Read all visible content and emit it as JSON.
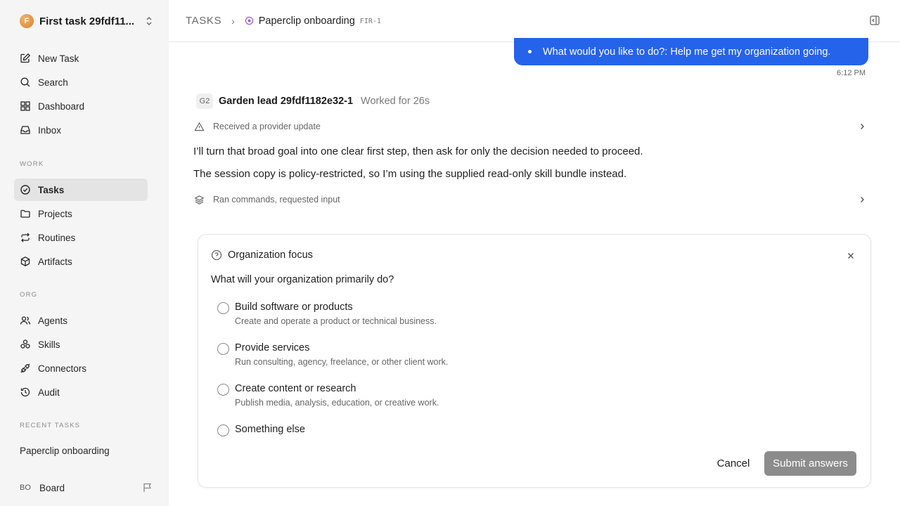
{
  "sidebar": {
    "org_name": "First task 29fdf11...",
    "org_initial": "F",
    "top_items": [
      {
        "label": "New Task",
        "icon": "edit-icon"
      },
      {
        "label": "Search",
        "icon": "search-icon"
      },
      {
        "label": "Dashboard",
        "icon": "dashboard-icon"
      },
      {
        "label": "Inbox",
        "icon": "inbox-icon"
      }
    ],
    "work_label": "WORK",
    "work_items": [
      {
        "label": "Tasks",
        "icon": "check-circle-icon"
      },
      {
        "label": "Projects",
        "icon": "folder-icon"
      },
      {
        "label": "Routines",
        "icon": "repeat-icon"
      },
      {
        "label": "Artifacts",
        "icon": "box-icon"
      }
    ],
    "org_label": "ORG",
    "org_items": [
      {
        "label": "Agents",
        "icon": "users-icon"
      },
      {
        "label": "Skills",
        "icon": "skills-icon"
      },
      {
        "label": "Connectors",
        "icon": "plug-icon"
      },
      {
        "label": "Audit",
        "icon": "history-icon"
      }
    ],
    "recent_label": "RECENT TASKS",
    "recent_items": [
      {
        "label": "Paperclip onboarding"
      }
    ],
    "board_initials": "BO",
    "board_label": "Board"
  },
  "header": {
    "root": "TASKS",
    "separator": "›",
    "title": "Paperclip onboarding",
    "task_id": "FIR-1"
  },
  "chat": {
    "user_message": "What would you like to do?: Help me get my organization going.",
    "user_time": "6:12 PM",
    "agent_badge": "G2",
    "agent_name": "Garden lead 29fdf1182e32-1",
    "agent_worked": "Worked for 26s",
    "activity_1": "Received a provider update",
    "para_1": "I’ll turn that broad goal into one clear first step, then ask for only the decision needed to proceed.",
    "para_2": "The session copy is policy-restricted, so I’m using the supplied read-only skill bundle instead.",
    "activity_2": "Ran commands, requested input"
  },
  "question_card": {
    "title": "Organization focus",
    "question": "What will your organization primarily do?",
    "options": [
      {
        "label": "Build software or products",
        "desc": "Create and operate a product or technical business."
      },
      {
        "label": "Provide services",
        "desc": "Run consulting, agency, freelance, or other client work."
      },
      {
        "label": "Create content or research",
        "desc": "Publish media, analysis, education, or creative work."
      },
      {
        "label": "Something else",
        "desc": ""
      }
    ],
    "cancel_label": "Cancel",
    "submit_label": "Submit answers"
  },
  "colors": {
    "accent": "#2563eb",
    "sidebar_bg": "#f5f5f5",
    "submit_disabled": "#8c8c8c"
  }
}
